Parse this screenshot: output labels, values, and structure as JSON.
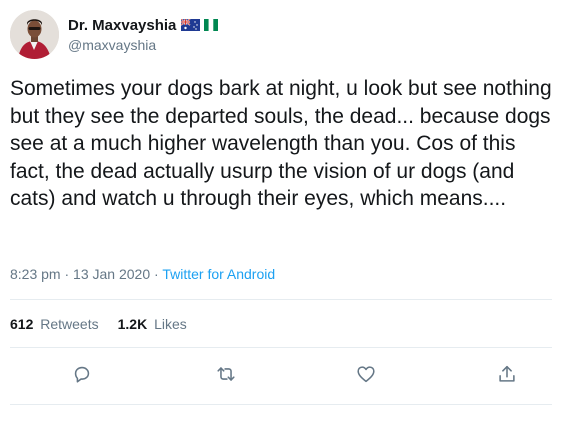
{
  "author": {
    "display_name": "Dr. Maxvayshia",
    "handle": "@maxvayshia",
    "flags": [
      "australia-flag",
      "nigeria-flag"
    ]
  },
  "tweet": {
    "text": "Sometimes your dogs bark at night, u look but see nothing but they see the departed souls, the dead... because dogs see at a much higher wavelength than you. Cos of this fact, the dead actually usurp the vision of ur dogs (and cats) and watch u through their eyes, which means....",
    "time": "8:23 pm",
    "separator": "·",
    "date": "13 Jan 2020",
    "source": "Twitter for Android"
  },
  "stats": {
    "retweets_count": "612",
    "retweets_label": "Retweets",
    "likes_count": "1.2K",
    "likes_label": "Likes"
  },
  "actions": [
    "reply-icon",
    "retweet-icon",
    "like-icon",
    "share-icon"
  ],
  "colors": {
    "text": "#14171a",
    "secondary": "#657786",
    "link": "#1da1f2",
    "divider": "#e6ecf0"
  }
}
